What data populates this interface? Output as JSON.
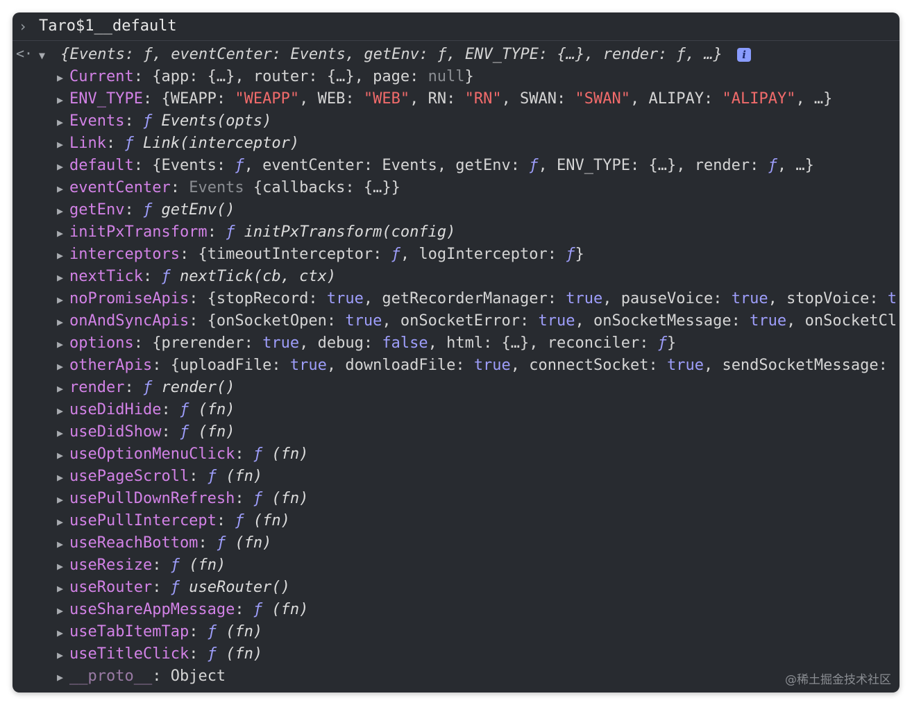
{
  "input": {
    "prompt_icon": "chevron-right-icon",
    "expression": "Taro$1__default"
  },
  "result": {
    "return_icon": "return-arrow-icon",
    "summary": "{Events: ƒ, eventCenter: Events, getEnv: ƒ, ENV_TYPE: {…}, render: ƒ, …}",
    "info_badge": "i"
  },
  "properties": [
    {
      "key": "Current",
      "parts": [
        {
          "t": ": {app: {…}, router: {…}, page: ",
          "c": "punc"
        },
        {
          "t": "null",
          "c": "grey"
        },
        {
          "t": "}",
          "c": "punc"
        }
      ]
    },
    {
      "key": "ENV_TYPE",
      "parts": [
        {
          "t": ": {WEAPP: ",
          "c": "punc"
        },
        {
          "t": "\"WEAPP\"",
          "c": "str-red"
        },
        {
          "t": ", WEB: ",
          "c": "punc"
        },
        {
          "t": "\"WEB\"",
          "c": "str-red"
        },
        {
          "t": ", RN: ",
          "c": "punc"
        },
        {
          "t": "\"RN\"",
          "c": "str-red"
        },
        {
          "t": ", SWAN: ",
          "c": "punc"
        },
        {
          "t": "\"SWAN\"",
          "c": "str-red"
        },
        {
          "t": ", ALIPAY: ",
          "c": "punc"
        },
        {
          "t": "\"ALIPAY\"",
          "c": "str-red"
        },
        {
          "t": ", …}",
          "c": "punc"
        }
      ]
    },
    {
      "key": "Events",
      "parts": [
        {
          "t": ": ",
          "c": "punc"
        },
        {
          "t": "ƒ ",
          "c": "fn"
        },
        {
          "t": "Events(opts)",
          "c": "fnname"
        }
      ]
    },
    {
      "key": "Link",
      "parts": [
        {
          "t": ": ",
          "c": "punc"
        },
        {
          "t": "ƒ ",
          "c": "fn"
        },
        {
          "t": "Link(interceptor)",
          "c": "fnname"
        }
      ]
    },
    {
      "key": "default",
      "parts": [
        {
          "t": ": {Events: ",
          "c": "punc"
        },
        {
          "t": "ƒ",
          "c": "fn"
        },
        {
          "t": ", eventCenter: Events, getEnv: ",
          "c": "punc"
        },
        {
          "t": "ƒ",
          "c": "fn"
        },
        {
          "t": ", ENV_TYPE: {…}, render: ",
          "c": "punc"
        },
        {
          "t": "ƒ",
          "c": "fn"
        },
        {
          "t": ", …}",
          "c": "punc"
        }
      ]
    },
    {
      "key": "eventCenter",
      "parts": [
        {
          "t": ": ",
          "c": "punc"
        },
        {
          "t": "Events",
          "c": "grey"
        },
        {
          "t": " {callbacks: {…}}",
          "c": "punc"
        }
      ]
    },
    {
      "key": "getEnv",
      "parts": [
        {
          "t": ": ",
          "c": "punc"
        },
        {
          "t": "ƒ ",
          "c": "fn"
        },
        {
          "t": "getEnv()",
          "c": "fnname"
        }
      ]
    },
    {
      "key": "initPxTransform",
      "parts": [
        {
          "t": ": ",
          "c": "punc"
        },
        {
          "t": "ƒ ",
          "c": "fn"
        },
        {
          "t": "initPxTransform(config)",
          "c": "fnname"
        }
      ]
    },
    {
      "key": "interceptors",
      "parts": [
        {
          "t": ": {timeoutInterceptor: ",
          "c": "punc"
        },
        {
          "t": "ƒ",
          "c": "fn"
        },
        {
          "t": ", logInterceptor: ",
          "c": "punc"
        },
        {
          "t": "ƒ",
          "c": "fn"
        },
        {
          "t": "}",
          "c": "punc"
        }
      ]
    },
    {
      "key": "nextTick",
      "parts": [
        {
          "t": ": ",
          "c": "punc"
        },
        {
          "t": "ƒ ",
          "c": "fn"
        },
        {
          "t": "nextTick(cb, ctx)",
          "c": "fnname"
        }
      ]
    },
    {
      "key": "noPromiseApis",
      "parts": [
        {
          "t": ": {stopRecord: ",
          "c": "punc"
        },
        {
          "t": "true",
          "c": "bool"
        },
        {
          "t": ", getRecorderManager: ",
          "c": "punc"
        },
        {
          "t": "true",
          "c": "bool"
        },
        {
          "t": ", pauseVoice: ",
          "c": "punc"
        },
        {
          "t": "true",
          "c": "bool"
        },
        {
          "t": ", stopVoice: ",
          "c": "punc"
        },
        {
          "t": "t",
          "c": "bool"
        }
      ]
    },
    {
      "key": "onAndSyncApis",
      "parts": [
        {
          "t": ": {onSocketOpen: ",
          "c": "punc"
        },
        {
          "t": "true",
          "c": "bool"
        },
        {
          "t": ", onSocketError: ",
          "c": "punc"
        },
        {
          "t": "true",
          "c": "bool"
        },
        {
          "t": ", onSocketMessage: ",
          "c": "punc"
        },
        {
          "t": "true",
          "c": "bool"
        },
        {
          "t": ", onSocketCl",
          "c": "punc"
        }
      ]
    },
    {
      "key": "options",
      "parts": [
        {
          "t": ": {prerender: ",
          "c": "punc"
        },
        {
          "t": "true",
          "c": "bool"
        },
        {
          "t": ", debug: ",
          "c": "punc"
        },
        {
          "t": "false",
          "c": "bool"
        },
        {
          "t": ", html: {…}, reconciler: ",
          "c": "punc"
        },
        {
          "t": "ƒ",
          "c": "fn"
        },
        {
          "t": "}",
          "c": "punc"
        }
      ]
    },
    {
      "key": "otherApis",
      "parts": [
        {
          "t": ": {uploadFile: ",
          "c": "punc"
        },
        {
          "t": "true",
          "c": "bool"
        },
        {
          "t": ", downloadFile: ",
          "c": "punc"
        },
        {
          "t": "true",
          "c": "bool"
        },
        {
          "t": ", connectSocket: ",
          "c": "punc"
        },
        {
          "t": "true",
          "c": "bool"
        },
        {
          "t": ", sendSocketMessage: ",
          "c": "punc"
        }
      ]
    },
    {
      "key": "render",
      "parts": [
        {
          "t": ": ",
          "c": "punc"
        },
        {
          "t": "ƒ ",
          "c": "fn"
        },
        {
          "t": "render()",
          "c": "fnname"
        }
      ]
    },
    {
      "key": "useDidHide",
      "parts": [
        {
          "t": ": ",
          "c": "punc"
        },
        {
          "t": "ƒ ",
          "c": "fn"
        },
        {
          "t": "(fn)",
          "c": "fnname"
        }
      ]
    },
    {
      "key": "useDidShow",
      "parts": [
        {
          "t": ": ",
          "c": "punc"
        },
        {
          "t": "ƒ ",
          "c": "fn"
        },
        {
          "t": "(fn)",
          "c": "fnname"
        }
      ]
    },
    {
      "key": "useOptionMenuClick",
      "parts": [
        {
          "t": ": ",
          "c": "punc"
        },
        {
          "t": "ƒ ",
          "c": "fn"
        },
        {
          "t": "(fn)",
          "c": "fnname"
        }
      ]
    },
    {
      "key": "usePageScroll",
      "parts": [
        {
          "t": ": ",
          "c": "punc"
        },
        {
          "t": "ƒ ",
          "c": "fn"
        },
        {
          "t": "(fn)",
          "c": "fnname"
        }
      ]
    },
    {
      "key": "usePullDownRefresh",
      "parts": [
        {
          "t": ": ",
          "c": "punc"
        },
        {
          "t": "ƒ ",
          "c": "fn"
        },
        {
          "t": "(fn)",
          "c": "fnname"
        }
      ]
    },
    {
      "key": "usePullIntercept",
      "parts": [
        {
          "t": ": ",
          "c": "punc"
        },
        {
          "t": "ƒ ",
          "c": "fn"
        },
        {
          "t": "(fn)",
          "c": "fnname"
        }
      ]
    },
    {
      "key": "useReachBottom",
      "parts": [
        {
          "t": ": ",
          "c": "punc"
        },
        {
          "t": "ƒ ",
          "c": "fn"
        },
        {
          "t": "(fn)",
          "c": "fnname"
        }
      ]
    },
    {
      "key": "useResize",
      "parts": [
        {
          "t": ": ",
          "c": "punc"
        },
        {
          "t": "ƒ ",
          "c": "fn"
        },
        {
          "t": "(fn)",
          "c": "fnname"
        }
      ]
    },
    {
      "key": "useRouter",
      "parts": [
        {
          "t": ": ",
          "c": "punc"
        },
        {
          "t": "ƒ ",
          "c": "fn"
        },
        {
          "t": "useRouter()",
          "c": "fnname"
        }
      ]
    },
    {
      "key": "useShareAppMessage",
      "parts": [
        {
          "t": ": ",
          "c": "punc"
        },
        {
          "t": "ƒ ",
          "c": "fn"
        },
        {
          "t": "(fn)",
          "c": "fnname"
        }
      ]
    },
    {
      "key": "useTabItemTap",
      "parts": [
        {
          "t": ": ",
          "c": "punc"
        },
        {
          "t": "ƒ ",
          "c": "fn"
        },
        {
          "t": "(fn)",
          "c": "fnname"
        }
      ]
    },
    {
      "key": "useTitleClick",
      "parts": [
        {
          "t": ": ",
          "c": "punc"
        },
        {
          "t": "ƒ ",
          "c": "fn"
        },
        {
          "t": "(fn)",
          "c": "fnname"
        }
      ]
    },
    {
      "key": "__proto__",
      "proto": true,
      "parts": [
        {
          "t": ": Object",
          "c": "punc"
        }
      ]
    }
  ],
  "watermark": "@稀土掘金技术社区",
  "colors": {
    "background": "#282b30",
    "key": "#d282e6",
    "string": "#f16b6b",
    "boolean": "#9e9efb",
    "function_keyword": "#9e9efb"
  }
}
